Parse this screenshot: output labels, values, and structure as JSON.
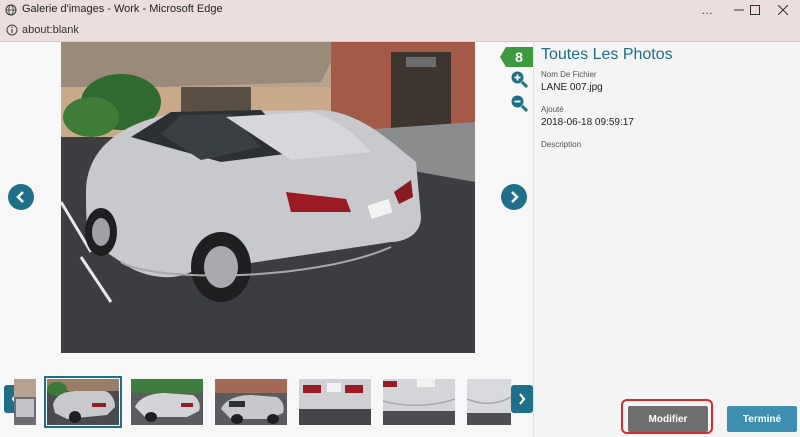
{
  "window": {
    "title": "Galerie d'images - Work - Microsoft Edge",
    "url": "about:blank"
  },
  "gallery": {
    "count": "8",
    "thumbnails": [
      {
        "name": "thumb-1",
        "selected": false
      },
      {
        "name": "thumb-2",
        "selected": true
      },
      {
        "name": "thumb-3",
        "selected": false
      },
      {
        "name": "thumb-4",
        "selected": false
      },
      {
        "name": "thumb-5",
        "selected": false
      },
      {
        "name": "thumb-6",
        "selected": false
      },
      {
        "name": "thumb-7",
        "selected": false
      }
    ]
  },
  "panel": {
    "title": "Toutes Les Photos",
    "filename_label": "Nom De Fichier",
    "filename": "LANE 007.jpg",
    "added_label": "Ajouté",
    "added": "2018-06-18 09:59:17",
    "description_label": "Description",
    "modify_label": "Modifier",
    "done_label": "Terminé"
  },
  "colors": {
    "accent": "#1d6f8a",
    "badge": "#3f9a3f",
    "modify_button": "#6f6f6f",
    "done_button": "#3d8fb0",
    "highlight_ring": "#d92a2a"
  }
}
